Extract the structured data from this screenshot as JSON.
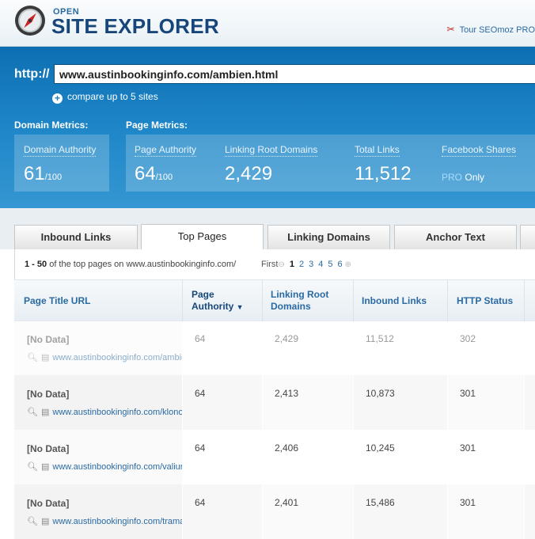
{
  "brand": {
    "open": "OPEN",
    "title": "SITE EXPLORER",
    "tour_icon": "tools-icon",
    "tour": "Tour SEOmoz PRO"
  },
  "search": {
    "http_label": "http://",
    "url": "www.austinbookinginfo.com/ambien.html",
    "compare": "compare up to 5 sites"
  },
  "metrics": {
    "domain_label": "Domain Metrics:",
    "page_label": "Page Metrics:",
    "domain_authority": {
      "title": "Domain Authority",
      "value": "61",
      "suffix": "/100"
    },
    "page_authority": {
      "title": "Page Authority",
      "value": "64",
      "suffix": "/100"
    },
    "linking_root_domains": {
      "title": "Linking Root Domains",
      "value": "2,429"
    },
    "total_links": {
      "title": "Total Links",
      "value": "11,512"
    },
    "facebook_shares": {
      "title": "Facebook Shares",
      "pro": "PRO",
      "only": "Only"
    }
  },
  "tabs": [
    {
      "label": "Inbound Links"
    },
    {
      "label": "Top Pages"
    },
    {
      "label": "Linking Domains"
    },
    {
      "label": "Anchor Text"
    }
  ],
  "pager": {
    "range": "1 - 50",
    "range_text": "of the top pages on www.austinbookinginfo.com/",
    "first": "First",
    "pages": [
      "1",
      "2",
      "3",
      "4",
      "5",
      "6"
    ]
  },
  "columns": {
    "title_url": "Page Title URL",
    "page_authority": "Page Authority",
    "linking_root_domains": "Linking Root Domains",
    "inbound_links": "Inbound Links",
    "http_status": "HTTP Status"
  },
  "rows": [
    {
      "title": "[No Data]",
      "url": "www.austinbookinginfo.com/ambien.html",
      "pa": "64",
      "lrd": "2,429",
      "links": "11,512",
      "status": "302"
    },
    {
      "title": "[No Data]",
      "url": "www.austinbookinginfo.com/klonopin.html",
      "pa": "64",
      "lrd": "2,413",
      "links": "10,873",
      "status": "301"
    },
    {
      "title": "[No Data]",
      "url": "www.austinbookinginfo.com/valium.html",
      "pa": "64",
      "lrd": "2,406",
      "links": "10,245",
      "status": "301"
    },
    {
      "title": "[No Data]",
      "url": "www.austinbookinginfo.com/tramadol.html",
      "pa": "64",
      "lrd": "2,401",
      "links": "15,486",
      "status": "301"
    }
  ],
  "colors": {
    "accent": "#1b7fc0",
    "link": "#2a6aa3",
    "brand_dark": "#17467a"
  }
}
